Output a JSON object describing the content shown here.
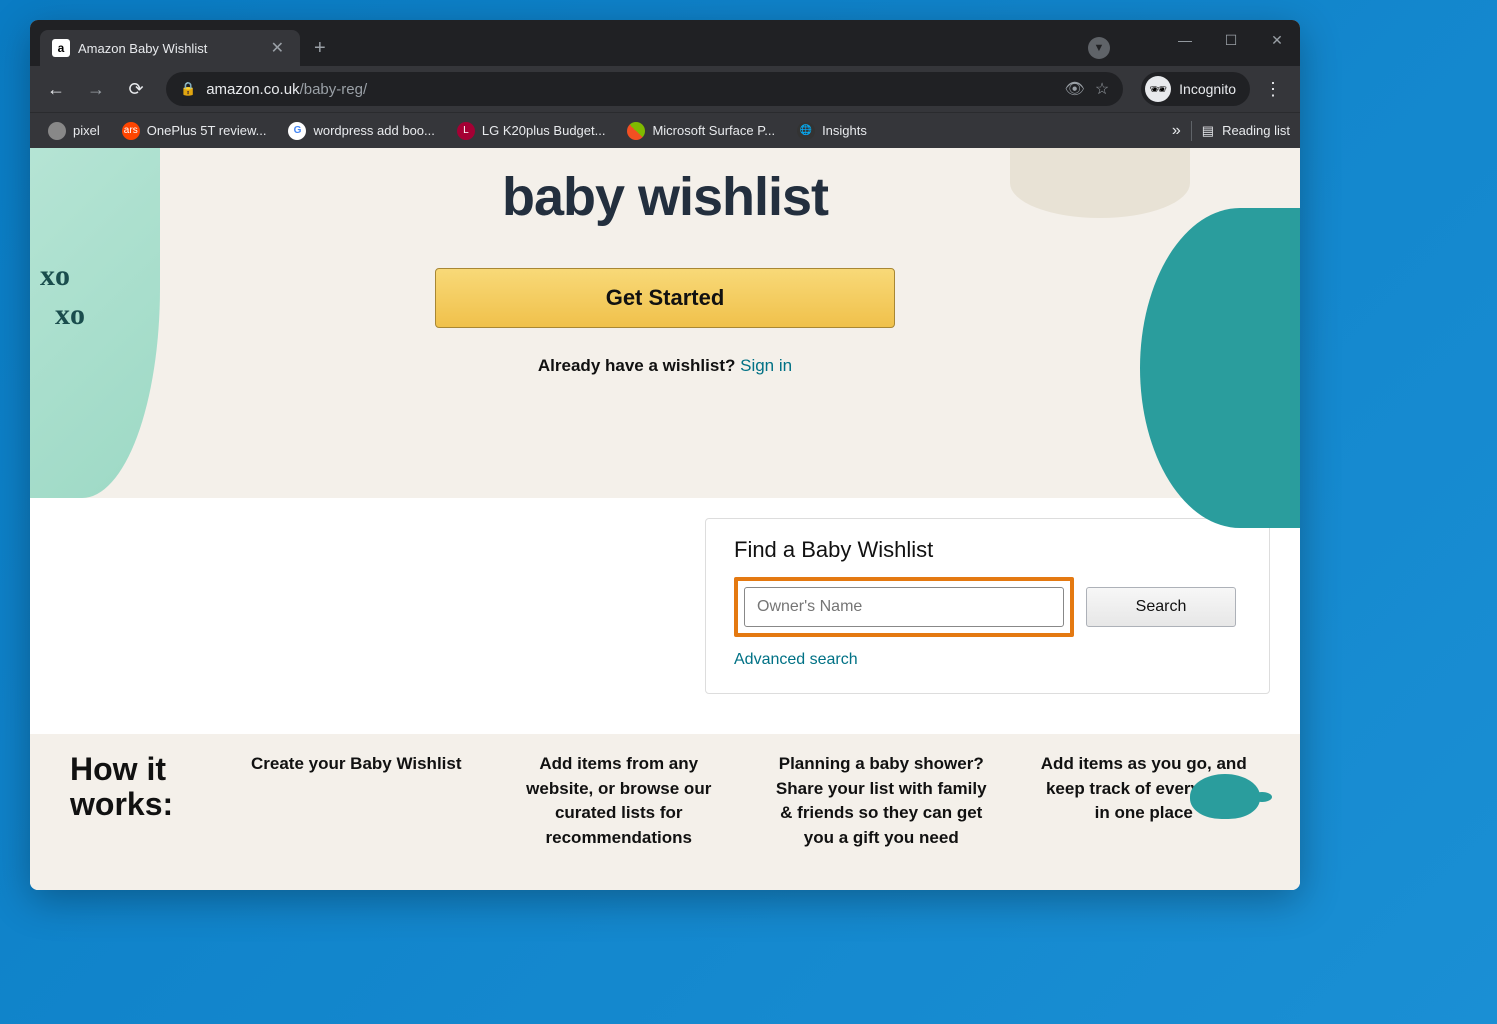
{
  "tab": {
    "title": "Amazon Baby Wishlist"
  },
  "url": {
    "domain": "amazon.co.uk",
    "path": "/baby-reg/"
  },
  "incognito": "Incognito",
  "bookmarks": [
    {
      "label": "pixel",
      "icon": "",
      "bg": "#888"
    },
    {
      "label": "OnePlus 5T review...",
      "icon": "ars",
      "bg": "#ff4500"
    },
    {
      "label": "wordpress add boo...",
      "icon": "G",
      "bg": "#fff"
    },
    {
      "label": "LG K20plus Budget...",
      "icon": "L",
      "bg": "#a50034"
    },
    {
      "label": "Microsoft Surface P...",
      "icon": "⊞",
      "bg": ""
    },
    {
      "label": "Insights",
      "icon": "🌐",
      "bg": "#333"
    }
  ],
  "readingList": "Reading list",
  "hero": {
    "title": "baby wishlist",
    "button": "Get Started",
    "signinText": "Already have a wishlist? ",
    "signinLink": "Sign in",
    "xo": "xo\n  xo"
  },
  "find": {
    "title": "Find a Baby Wishlist",
    "placeholder": "Owner's Name",
    "searchBtn": "Search",
    "advanced": "Advanced search"
  },
  "how": {
    "title": "How it works:",
    "cols": [
      "Create your Baby Wishlist",
      "Add items from any website, or browse our curated lists for recommendations",
      "Planning a baby shower? Share your list with family & friends so they can get you a gift you need",
      "Add items as you go, and keep track of everything in one place"
    ]
  }
}
